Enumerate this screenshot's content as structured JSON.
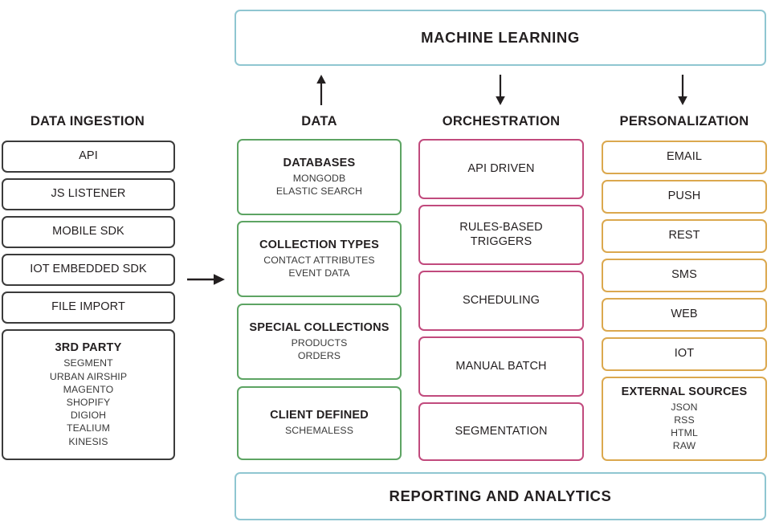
{
  "banners": {
    "top": {
      "label": "MACHINE LEARNING",
      "color": "#8fc6d1"
    },
    "bottom": {
      "label": "REPORTING AND ANALYTICS",
      "color": "#8fc6d1"
    }
  },
  "arrows": {
    "ingestion_to_data": "arrow-right",
    "data_to_ml": "arrow-up",
    "ml_to_orchestration": "arrow-down",
    "ml_to_personalization": "arrow-down"
  },
  "columns": [
    {
      "id": "data-ingestion",
      "heading": "DATA INGESTION",
      "color": "#3b3b3b",
      "items": [
        {
          "title": "API",
          "bold": false,
          "sub": []
        },
        {
          "title": "JS LISTENER",
          "bold": false,
          "sub": []
        },
        {
          "title": "MOBILE SDK",
          "bold": false,
          "sub": []
        },
        {
          "title": "IOT EMBEDDED SDK",
          "bold": false,
          "sub": []
        },
        {
          "title": "FILE IMPORT",
          "bold": false,
          "sub": []
        },
        {
          "title": "3RD PARTY",
          "bold": true,
          "sub": [
            "SEGMENT",
            "URBAN AIRSHIP",
            "MAGENTO",
            "SHOPIFY",
            "DIGIOH",
            "TEALIUM",
            "KINESIS"
          ]
        }
      ]
    },
    {
      "id": "data",
      "heading": "DATA",
      "color": "#5da463",
      "items": [
        {
          "title": "DATABASES",
          "bold": true,
          "sub": [
            "MONGODB",
            "ELASTIC SEARCH"
          ]
        },
        {
          "title": "COLLECTION TYPES",
          "bold": true,
          "sub": [
            "CONTACT ATTRIBUTES",
            "EVENT DATA"
          ]
        },
        {
          "title": "SPECIAL COLLECTIONS",
          "bold": true,
          "sub": [
            "PRODUCTS",
            "ORDERS"
          ]
        },
        {
          "title": "CLIENT DEFINED",
          "bold": true,
          "sub": [
            "SCHEMALESS"
          ]
        }
      ]
    },
    {
      "id": "orchestration",
      "heading": "ORCHESTRATION",
      "color": "#c14a7d",
      "items": [
        {
          "title": "API DRIVEN",
          "bold": false,
          "sub": []
        },
        {
          "title": "RULES-BASED\nTRIGGERS",
          "bold": false,
          "sub": []
        },
        {
          "title": "SCHEDULING",
          "bold": false,
          "sub": []
        },
        {
          "title": "MANUAL BATCH",
          "bold": false,
          "sub": []
        },
        {
          "title": "SEGMENTATION",
          "bold": false,
          "sub": []
        }
      ]
    },
    {
      "id": "personalization",
      "heading": "PERSONALIZATION",
      "color": "#dba84e",
      "items": [
        {
          "title": "EMAIL",
          "bold": false,
          "sub": []
        },
        {
          "title": "PUSH",
          "bold": false,
          "sub": []
        },
        {
          "title": "REST",
          "bold": false,
          "sub": []
        },
        {
          "title": "SMS",
          "bold": false,
          "sub": []
        },
        {
          "title": "WEB",
          "bold": false,
          "sub": []
        },
        {
          "title": "IOT",
          "bold": false,
          "sub": []
        },
        {
          "title": "EXTERNAL SOURCES",
          "bold": true,
          "sub": [
            "JSON",
            "RSS",
            "HTML",
            "RAW"
          ]
        }
      ]
    }
  ]
}
